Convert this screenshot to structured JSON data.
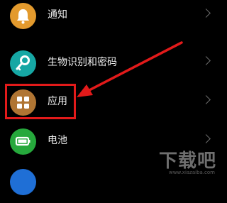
{
  "items": [
    {
      "label": "通知",
      "icon": "bell-icon",
      "color": "#e39a2d"
    },
    {
      "label": "生物识别和密码",
      "icon": "key-icon",
      "color": "#16a7a4"
    },
    {
      "label": "应用",
      "icon": "apps-grid-icon",
      "color": "#b07533"
    },
    {
      "label": "电池",
      "icon": "battery-icon",
      "color": "#26a83c"
    }
  ],
  "colors": {
    "background": "#000000",
    "highlight": "#e21a1a"
  },
  "watermark": {
    "text": "下载吧",
    "subtext": "www.xiazaiba.com"
  }
}
